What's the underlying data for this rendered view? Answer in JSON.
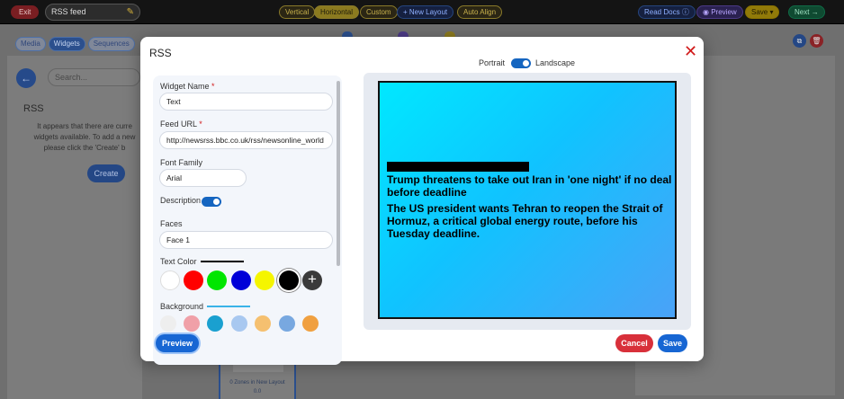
{
  "topbar": {
    "exit_label": "Exit",
    "layout_name": "RSS feed",
    "orientation_options": [
      "Vertical",
      "Horizontal",
      "Custom"
    ],
    "active_orientation": "Horizontal",
    "new_layout_label": "+ New Layout",
    "auto_align_label": "Auto Align",
    "read_docs_label": "Read Docs",
    "preview_label": "Preview",
    "save_label": "Save",
    "next_label": "Next"
  },
  "sidebar": {
    "tabs": [
      "Media",
      "Widgets",
      "Sequences"
    ],
    "active_tab": "Widgets",
    "search_placeholder": "Search...",
    "heading": "RSS",
    "message": "It appears that there are curre widgets available. To add a new please click the 'Create' b",
    "create_label": "Create"
  },
  "zone_card": {
    "caption": "0 Zones in New Layout",
    "value": "0.0"
  },
  "modal": {
    "title": "RSS",
    "fields": {
      "widget_name_label": "Widget Name",
      "widget_name_value": "Text",
      "feed_url_label": "Feed URL",
      "feed_url_value": "http://newsrss.bbc.co.uk/rss/newsonline_world",
      "font_family_label": "Font Family",
      "font_family_value": "Arial",
      "description_label": "Description",
      "description_enabled": true,
      "faces_label": "Faces",
      "faces_value": "Face 1",
      "text_color_label": "Text Color",
      "background_label": "Background"
    },
    "text_colors": [
      "#ffffff",
      "#ff0000",
      "#00e600",
      "#0000d8",
      "#f5f500",
      "#000000"
    ],
    "selected_text_color": "#000000",
    "background_colors": [
      "#f0a0a8",
      "#1aa0d0",
      "#a8c8f0",
      "#f5c070",
      "#78a8e0",
      "#f0a040"
    ],
    "orientation": {
      "portrait_label": "Portrait",
      "landscape_label": "Landscape",
      "selected": "Landscape"
    },
    "preview_content": {
      "headline": "Trump threatens to take out Iran in 'one night' if no deal before deadline",
      "description": "The US president wants Tehran to reopen the Strait of Hormuz, a critical global energy route, before his Tuesday deadline."
    },
    "buttons": {
      "preview": "Preview",
      "cancel": "Cancel",
      "save": "Save"
    }
  }
}
